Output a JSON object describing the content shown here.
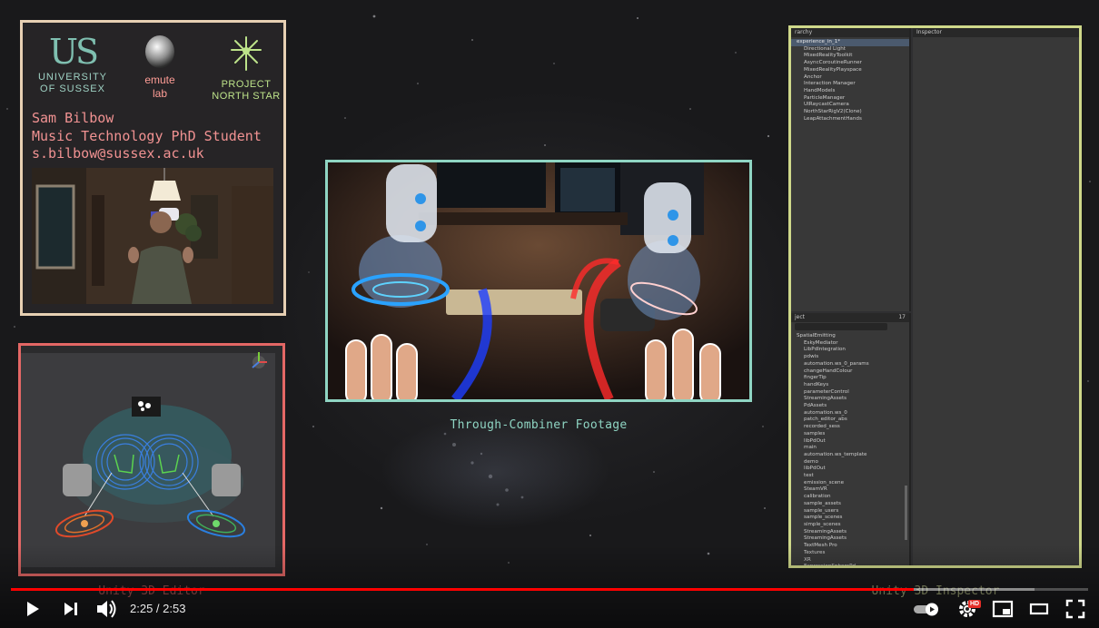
{
  "affiliations": {
    "university_mark": "US",
    "university_name": "UNIVERSITY OF SUSSEX",
    "lab_line1": "emute",
    "lab_line2": "lab",
    "project_line1": "PROJECT",
    "project_line2": "NORTH STAR"
  },
  "presenter": {
    "name": "Sam Bilbow",
    "role": "Music Technology PhD Student",
    "email": "s.bilbow@sussex.ac.uk"
  },
  "captions": {
    "footage": "Through-Combiner Footage",
    "editor": "Unity 3D Editor",
    "inspector": "Unity 3D Inspector"
  },
  "unity": {
    "hierarchy_tab": "rarchy",
    "inspector_tab": "Inspector",
    "hierarchy_items": [
      "experience_in_1*",
      "Directional Light",
      "MixedRealityToolkit",
      "AsyncCoroutineRunner",
      "MixedRealityPlayspace",
      "Anchor",
      "Interaction Manager",
      "HandModels",
      "ParticleManager",
      "UIRaycastCamera",
      "NorthStarRigV2(Clone)",
      "LeapAttachmentHands"
    ],
    "project_tab": "ject",
    "project_count": "17",
    "project_items": [
      "SpatialEmitting",
      "EskyMediator",
      "LibPdIntegration",
      "pdwis",
      "automation.ws_0_params",
      "changeHandColour",
      "fingerTip",
      "handKeys",
      "parameterControl",
      "StreamingAssets",
      "PdAssets",
      "automation.ws_0",
      "patch_editor_abs",
      "recorded_sess",
      "samples",
      "libPdOut",
      "main",
      "automation.ws_template",
      "demo",
      "libPdOut",
      "test",
      "emission_scene",
      "SteamVR",
      "calibration",
      "sample_assets",
      "sample_users",
      "sample_scenes",
      "simple_scenes",
      "StreamingAssets",
      "StreamingAssets",
      "TextMesh Pro",
      "Textures",
      "XR",
      "ExpressionSpherePd"
    ]
  },
  "player": {
    "current_time": "2:25",
    "duration": "2:53",
    "time_display": "2:25 / 2:53",
    "progress": 0.838,
    "buffered": 0.95,
    "hd_label": "HD",
    "accent_color": "#ff0000",
    "icons": [
      "play-icon",
      "next-icon",
      "volume-icon",
      "autoplay-toggle-icon",
      "settings-icon",
      "miniplayer-icon",
      "theater-icon",
      "fullscreen-icon"
    ]
  }
}
